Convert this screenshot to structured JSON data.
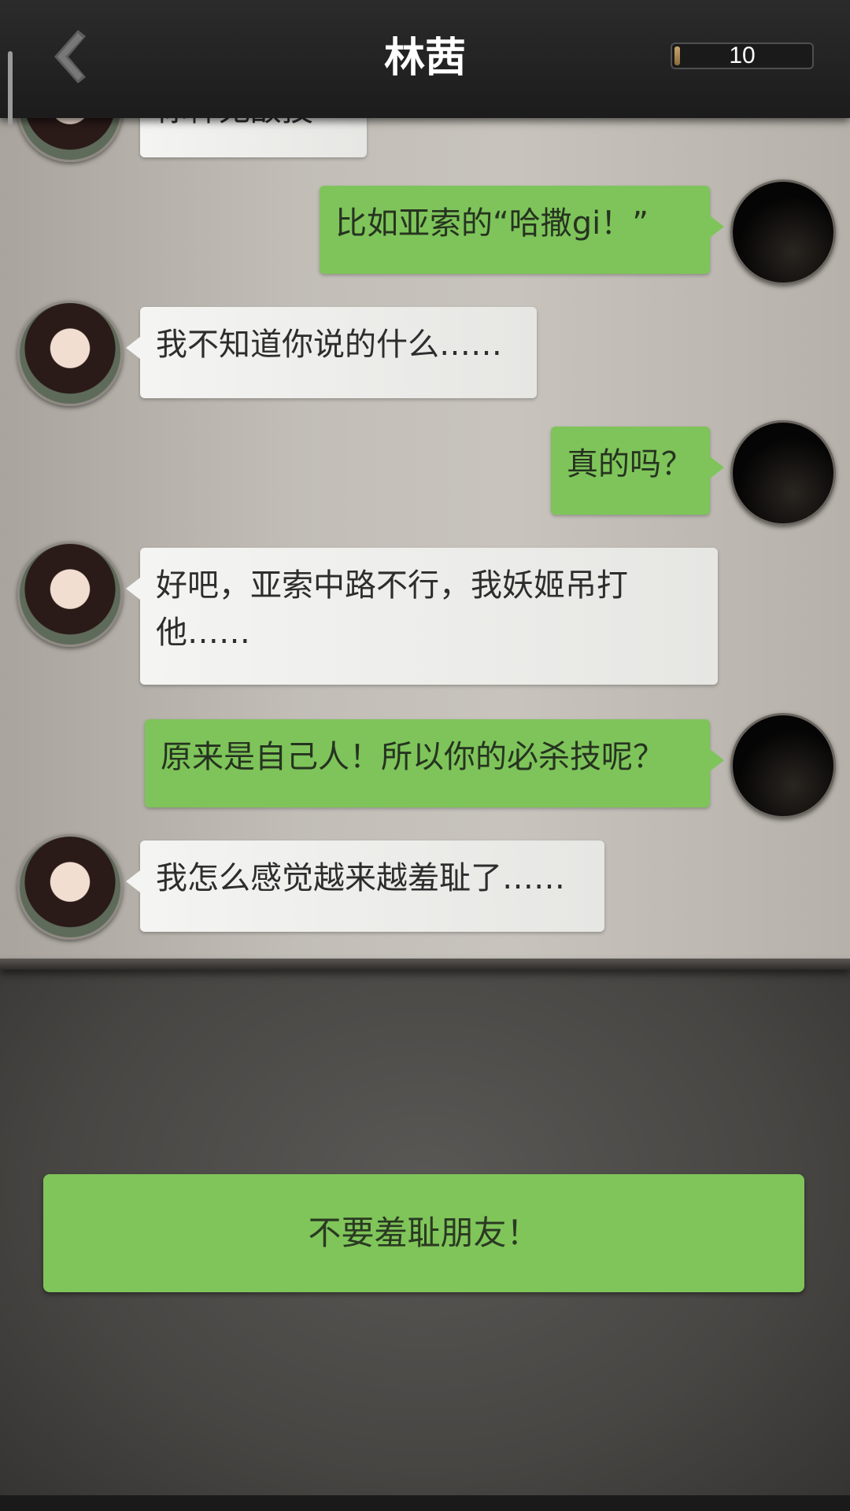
{
  "header": {
    "title": "林茜",
    "counter_value": "10",
    "counter_fill_fraction": 0.04,
    "back_icon": "chevron-left-icon"
  },
  "messages": [
    {
      "sender": "her",
      "text": "你神无敌技"
    },
    {
      "sender": "me",
      "text": "比如亚索的“哈撒gi！”"
    },
    {
      "sender": "her",
      "text": "我不知道你说的什么……"
    },
    {
      "sender": "me",
      "text": "真的吗？"
    },
    {
      "sender": "her",
      "text": "好吧，亚索中路不行，我妖姬吊打他……"
    },
    {
      "sender": "me",
      "text": "原来是自己人！所以你的必杀技呢？"
    },
    {
      "sender": "her",
      "text": "我怎么感觉越来越羞耻了……"
    }
  ],
  "choice": {
    "label": "不要羞耻朋友！"
  },
  "colors": {
    "my_bubble": "#7ec45a",
    "her_bubble": "#f0f0ee",
    "header_bg": "#222222",
    "choice_button": "#80c55a"
  }
}
